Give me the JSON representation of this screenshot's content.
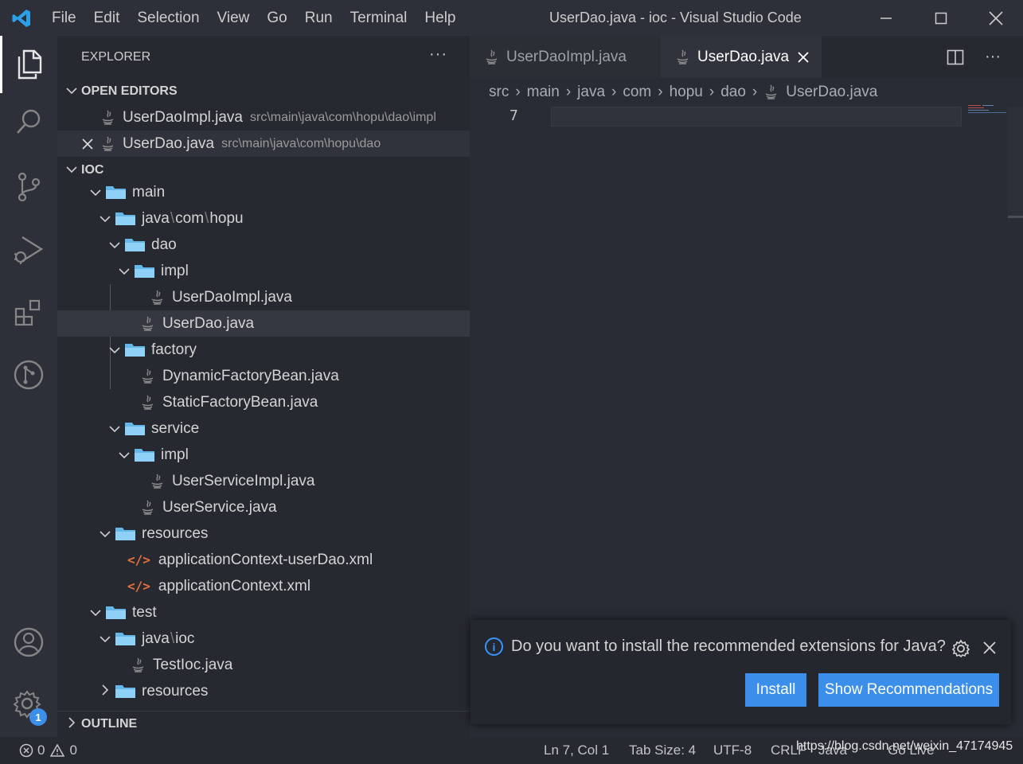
{
  "window": {
    "title": "UserDao.java - ioc - Visual Studio Code",
    "menu": [
      "File",
      "Edit",
      "Selection",
      "View",
      "Go",
      "Run",
      "Terminal",
      "Help"
    ]
  },
  "activity_bar": {
    "items": [
      "explorer-icon",
      "search-icon",
      "source-control-icon",
      "run-debug-icon",
      "extensions-icon",
      "git-graph-icon"
    ],
    "bottom": [
      "accounts-icon",
      "manage-gear-icon"
    ],
    "manage_badge": "1"
  },
  "sidebar": {
    "header": "EXPLORER",
    "more": "···",
    "open_editors_title": "OPEN EDITORS",
    "open_editors": [
      {
        "name": "UserDaoImpl.java",
        "path": "src\\main\\java\\com\\hopu\\dao\\impl",
        "selected": false
      },
      {
        "name": "UserDao.java",
        "path": "src\\main\\java\\com\\hopu\\dao",
        "selected": true
      }
    ],
    "project_title": "IOC",
    "tree": {
      "main": "main",
      "java_parts": [
        "java",
        "com",
        "hopu"
      ],
      "dao": "dao",
      "dao_impl": "impl",
      "userdaoimpl": "UserDaoImpl.java",
      "userdao": "UserDao.java",
      "factory": "factory",
      "dynamic": "DynamicFactoryBean.java",
      "static": "StaticFactoryBean.java",
      "service": "service",
      "service_impl": "impl",
      "userserviceimpl": "UserServiceImpl.java",
      "userservice": "UserService.java",
      "resources": "resources",
      "xml1": "applicationContext-userDao.xml",
      "xml2": "applicationContext.xml",
      "test": "test",
      "test_java_parts": [
        "java",
        "ioc"
      ],
      "testioc": "TestIoc.java",
      "test_resources": "resources"
    },
    "outline_title": "OUTLINE"
  },
  "editor": {
    "tabs": [
      {
        "label": "UserDaoImpl.java",
        "active": false
      },
      {
        "label": "UserDao.java",
        "active": true
      }
    ],
    "breadcrumb": [
      "src",
      "main",
      "java",
      "com",
      "hopu",
      "dao",
      "UserDao.java"
    ],
    "line_number": "7"
  },
  "notification": {
    "message": "Do you want to install the recommended extensions for Java?",
    "install_label": "Install",
    "show_label": "Show Recommendations"
  },
  "statusbar": {
    "errors": "0",
    "warnings": "0",
    "position": "Ln 7, Col 1",
    "tab_size": "Tab Size: 4",
    "encoding": "UTF-8",
    "eol": "CRLF",
    "language": "Java",
    "go_live": "Go Live",
    "watermark": "https://blog.csdn.net/weixin_47174945"
  },
  "colors": {
    "accent": "#3b8eea",
    "folder": "#65b7e8",
    "xml": "#e8703a"
  }
}
